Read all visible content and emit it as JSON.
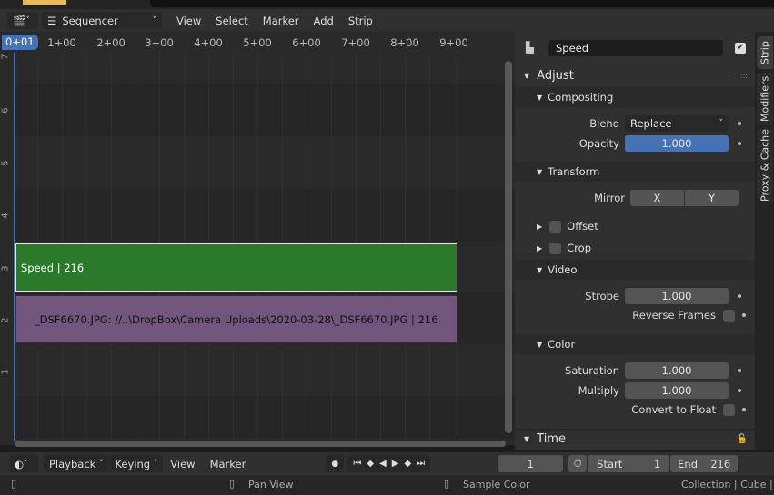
{
  "header": {
    "editor": "Sequencer",
    "menus": [
      "View",
      "Select",
      "Marker",
      "Add",
      "Strip"
    ]
  },
  "ruler": {
    "current": "0+01",
    "ticks": [
      "1+00",
      "2+00",
      "3+00",
      "4+00",
      "5+00",
      "6+00",
      "7+00",
      "8+00",
      "9+00"
    ]
  },
  "channels": [
    "7",
    "6",
    "5",
    "4",
    "3",
    "2",
    "1"
  ],
  "strips": {
    "speed": "Speed | 216",
    "image": "_DSF6670.JPG: //..\\DropBox\\Camera Uploads\\2020-03-28\\_DSF6670.JPG | 216"
  },
  "panel": {
    "name": "Speed",
    "adjust": "Adjust",
    "compositing": "Compositing",
    "blend_label": "Blend",
    "blend": "Replace",
    "opacity_label": "Opacity",
    "opacity": "1.000",
    "opacity_fraction": 1.0,
    "transform": "Transform",
    "mirror_label": "Mirror",
    "mirror_x": "X",
    "mirror_y": "Y",
    "offset": "Offset",
    "crop": "Crop",
    "video": "Video",
    "strobe_label": "Strobe",
    "strobe": "1.000",
    "reverse": "Reverse Frames",
    "color": "Color",
    "saturation_label": "Saturation",
    "saturation": "1.000",
    "multiply_label": "Multiply",
    "multiply": "1.000",
    "convert": "Convert to Float",
    "time": "Time"
  },
  "tabs": [
    "Strip",
    "Modifiers",
    "Proxy & Cache"
  ],
  "timeline": {
    "menus": [
      "Playback",
      "Keying",
      "View",
      "Marker"
    ],
    "frame": "1",
    "start_label": "Start",
    "start": "1",
    "end_label": "End",
    "end": "216"
  },
  "status": {
    "pan": "Pan View",
    "sample": "Sample Color",
    "info": "Collection | Cube | Ve"
  },
  "colors": {
    "accent": "#4772b3",
    "speed_strip": "#2b7a2b",
    "image_strip": "#73567e"
  }
}
